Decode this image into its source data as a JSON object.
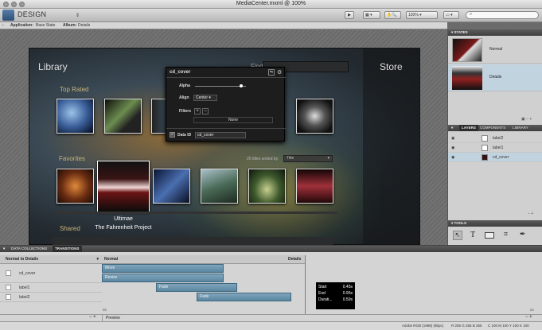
{
  "window": {
    "title": "MediaCenter.mxml @ 100%"
  },
  "toolbar": {
    "mode": "DESIGN",
    "zoom": "100%"
  },
  "breadcrumb": {
    "app_label": "Application:",
    "app_value": "Base State",
    "album_label": "Album:",
    "album_value": "Details"
  },
  "stage": {
    "library_title": "Library",
    "store_title": "Store",
    "find_label": "Find",
    "top_rated_label": "Top Rated",
    "favorites_label": "Favorites",
    "shared_label": "Shared",
    "sort_text": "20 titles sorted by:",
    "sort_value": "Title",
    "selected_title": "Ultimae",
    "selected_subtitle": "The Fahrenheit Project"
  },
  "popup": {
    "title": "cd_cover",
    "alpha_label": "Alpha",
    "alpha_value": 0.9,
    "align_label": "Align",
    "align_value": "Center",
    "filters_label": "Filters",
    "filters_value": "None",
    "dataid_label": "Data ID",
    "dataid_value": "cd_cover"
  },
  "states": {
    "header": "STATES",
    "items": [
      {
        "label": "Normal"
      },
      {
        "label": "Details"
      }
    ]
  },
  "layers": {
    "tabs": [
      "LAYERS",
      "COMPONENTS",
      "LIBRARY"
    ],
    "items": [
      {
        "label": "label2"
      },
      {
        "label": "label1"
      },
      {
        "label": "cd_cover"
      }
    ]
  },
  "tools": {
    "header": "TOOLS"
  },
  "bottom": {
    "tabs": [
      "DATA COLLECTIONS",
      "TRANSITIONS"
    ],
    "transition": "Normal to Details",
    "from_state": "Normal",
    "to_state": "Details",
    "targets": [
      "cd_cover",
      "label1",
      "label2"
    ],
    "effects": [
      {
        "label": "Move",
        "start": 0,
        "end": 0.45
      },
      {
        "label": "Resize",
        "start": 0,
        "end": 0.45
      },
      {
        "label": "Fade",
        "start": 0.2,
        "end": 0.5
      },
      {
        "label": "Fade",
        "start": 0.35,
        "end": 0.7
      }
    ],
    "time_start_label": "0s",
    "zoom_label": "2x",
    "preview_label": "Preview"
  },
  "tooltip": {
    "start_label": "Start",
    "start_value": "0.45s",
    "end_label": "End",
    "end_value": "0.95s",
    "duration_label": "Durati...",
    "duration_value": "0.50s"
  },
  "statusbar": {
    "profile": "Adobe RGB (1998) (8bpc)",
    "rgb": "R 255 G 255 B 255",
    "cmyk": "C 100 M 100 Y 100 K 100"
  },
  "colors": {
    "accent": "#5b86a0",
    "panel": "#d0d0d0",
    "selection": "#c2d3e0"
  }
}
